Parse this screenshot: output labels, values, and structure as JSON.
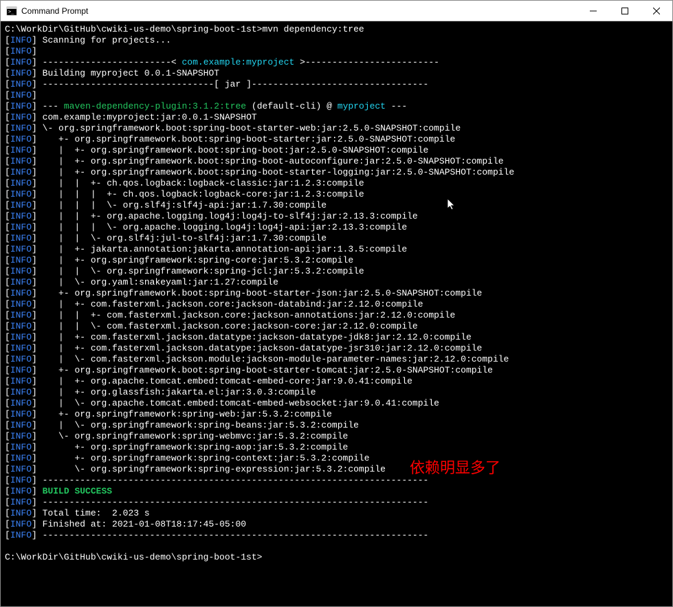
{
  "window": {
    "title": "Command Prompt"
  },
  "prompt1": "C:\\WorkDir\\GitHub\\cwiki-us-demo\\spring-boot-1st>",
  "command": "mvn dependency:tree",
  "info_label": "INFO",
  "lines": {
    "scanning": "Scanning for projects...",
    "header_dash_left": "------------------------<",
    "header_dash_right": ">-------------------------",
    "header_project": "com.example:myproject",
    "building": "Building myproject 0.0.1-SNAPSHOT",
    "jar_line": "--------------------------------[ jar ]---------------------------------",
    "plugin_prefix": "---",
    "plugin_name": "maven-dependency-plugin:3.1.2:tree",
    "plugin_default": "(default-cli) @",
    "plugin_project": "myproject",
    "plugin_suffix": "---",
    "depRoot": "com.example:myproject:jar:0.0.1-SNAPSHOT"
  },
  "tree": [
    "\\- org.springframework.boot:spring-boot-starter-web:jar:2.5.0-SNAPSHOT:compile",
    "   +- org.springframework.boot:spring-boot-starter:jar:2.5.0-SNAPSHOT:compile",
    "   |  +- org.springframework.boot:spring-boot:jar:2.5.0-SNAPSHOT:compile",
    "   |  +- org.springframework.boot:spring-boot-autoconfigure:jar:2.5.0-SNAPSHOT:compile",
    "   |  +- org.springframework.boot:spring-boot-starter-logging:jar:2.5.0-SNAPSHOT:compile",
    "   |  |  +- ch.qos.logback:logback-classic:jar:1.2.3:compile",
    "   |  |  |  +- ch.qos.logback:logback-core:jar:1.2.3:compile",
    "   |  |  |  \\- org.slf4j:slf4j-api:jar:1.7.30:compile",
    "   |  |  +- org.apache.logging.log4j:log4j-to-slf4j:jar:2.13.3:compile",
    "   |  |  |  \\- org.apache.logging.log4j:log4j-api:jar:2.13.3:compile",
    "   |  |  \\- org.slf4j:jul-to-slf4j:jar:1.7.30:compile",
    "   |  +- jakarta.annotation:jakarta.annotation-api:jar:1.3.5:compile",
    "   |  +- org.springframework:spring-core:jar:5.3.2:compile",
    "   |  |  \\- org.springframework:spring-jcl:jar:5.3.2:compile",
    "   |  \\- org.yaml:snakeyaml:jar:1.27:compile",
    "   +- org.springframework.boot:spring-boot-starter-json:jar:2.5.0-SNAPSHOT:compile",
    "   |  +- com.fasterxml.jackson.core:jackson-databind:jar:2.12.0:compile",
    "   |  |  +- com.fasterxml.jackson.core:jackson-annotations:jar:2.12.0:compile",
    "   |  |  \\- com.fasterxml.jackson.core:jackson-core:jar:2.12.0:compile",
    "   |  +- com.fasterxml.jackson.datatype:jackson-datatype-jdk8:jar:2.12.0:compile",
    "   |  +- com.fasterxml.jackson.datatype:jackson-datatype-jsr310:jar:2.12.0:compile",
    "   |  \\- com.fasterxml.jackson.module:jackson-module-parameter-names:jar:2.12.0:compile",
    "   +- org.springframework.boot:spring-boot-starter-tomcat:jar:2.5.0-SNAPSHOT:compile",
    "   |  +- org.apache.tomcat.embed:tomcat-embed-core:jar:9.0.41:compile",
    "   |  +- org.glassfish:jakarta.el:jar:3.0.3:compile",
    "   |  \\- org.apache.tomcat.embed:tomcat-embed-websocket:jar:9.0.41:compile",
    "   +- org.springframework:spring-web:jar:5.3.2:compile",
    "   |  \\- org.springframework:spring-beans:jar:5.3.2:compile",
    "   \\- org.springframework:spring-webmvc:jar:5.3.2:compile",
    "      +- org.springframework:spring-aop:jar:5.3.2:compile",
    "      +- org.springframework:spring-context:jar:5.3.2:compile",
    "      \\- org.springframework:spring-expression:jar:5.3.2:compile"
  ],
  "dashes": "------------------------------------------------------------------------",
  "build_success": "BUILD SUCCESS",
  "total_time": "Total time:  2.023 s",
  "finished_at": "Finished at: 2021-01-08T18:17:45-05:00",
  "prompt2": "C:\\WorkDir\\GitHub\\cwiki-us-demo\\spring-boot-1st>",
  "annotation": "依赖明显多了"
}
